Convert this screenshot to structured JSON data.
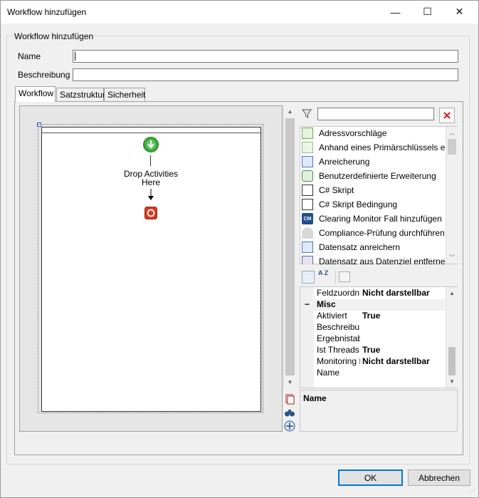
{
  "window": {
    "title": "Workflow hinzufügen",
    "minimize": "—",
    "maximize": "☐",
    "close": "✕"
  },
  "group": {
    "label": "Workflow hinzufügen"
  },
  "form": {
    "name_label": "Name",
    "name_value": "",
    "description_label": "Beschreibung",
    "description_value": ""
  },
  "tabs": [
    {
      "label": "Workflow",
      "active": true
    },
    {
      "label": "Satzstruktur",
      "active": false
    },
    {
      "label": "Sicherheit",
      "active": false
    }
  ],
  "designer": {
    "drop_text_line1": "Drop Activities",
    "drop_text_line2": "Here"
  },
  "toolbox": {
    "filter_value": "",
    "items": [
      {
        "label": "Adressvorschläge",
        "icon": "address-suggestions-icon"
      },
      {
        "label": "Anhand eines Primärschlüssels einen",
        "icon": "primary-key-icon"
      },
      {
        "label": "Anreicherung",
        "icon": "enrichment-icon"
      },
      {
        "label": "Benutzerdefinierte Erweiterung",
        "icon": "custom-extension-icon"
      },
      {
        "label": "C# Skript",
        "icon": "script-icon"
      },
      {
        "label": "C# Skript Bedingung",
        "icon": "script-condition-icon"
      },
      {
        "label": "Clearing Monitor Fall hinzufügen",
        "icon": "clearing-monitor-icon"
      },
      {
        "label": "Compliance-Prüfung durchführen",
        "icon": "compliance-icon"
      },
      {
        "label": "Datensatz anreichern",
        "icon": "record-enrich-icon"
      },
      {
        "label": "Datensatz aus Datenziel entfernen",
        "icon": "record-remove-icon"
      }
    ],
    "clearing_monitor_badge": "CM"
  },
  "properties": {
    "rows": [
      {
        "name": "Feldzuordn",
        "value": "Nicht darstellbar"
      },
      {
        "name": "Misc",
        "value": "",
        "category": true,
        "expander": "−"
      },
      {
        "name": "Aktiviert",
        "value": "True"
      },
      {
        "name": "Beschreibu",
        "value": ""
      },
      {
        "name": "Ergebnistab",
        "value": ""
      },
      {
        "name": "Ist Threads",
        "value": "True"
      },
      {
        "name": "Monitoring I",
        "value": "Nicht darstellbar"
      },
      {
        "name": "Name",
        "value": ""
      }
    ],
    "description_title": "Name",
    "sort_alpha_label": "A Z"
  },
  "buttons": {
    "ok": "OK",
    "cancel": "Abbrechen"
  },
  "colors": {
    "start": "#3aa63a",
    "stop": "#d9381e",
    "accent": "#0078d7"
  }
}
